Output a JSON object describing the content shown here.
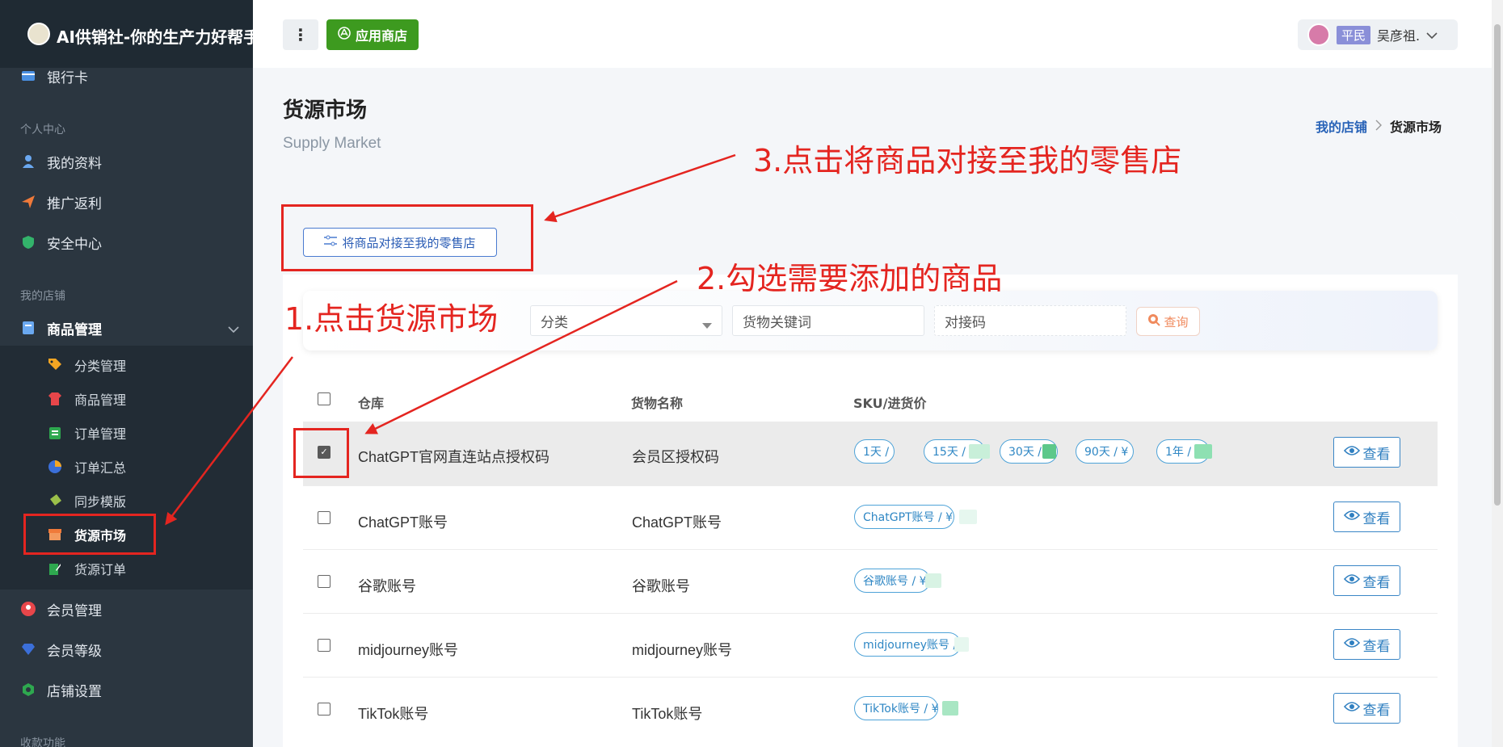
{
  "app": {
    "title": "AI供销社-你的生产力好帮手"
  },
  "header": {
    "store_button": "应用商店",
    "user_rank": "平民",
    "user_name": "吴彦祖."
  },
  "sidebar": {
    "top_item": "银行卡",
    "section_personal": "个人中心",
    "personal_items": [
      "我的资料",
      "推广返利",
      "安全中心"
    ],
    "section_store": "我的店铺",
    "goods_menu": "商品管理",
    "sub_items": [
      "分类管理",
      "商品管理",
      "订单管理",
      "订单汇总",
      "同步模版",
      "货源市场",
      "货源订单"
    ],
    "bottom_items": [
      "会员管理",
      "会员等级",
      "店铺设置"
    ],
    "section_payment": "收款功能"
  },
  "page": {
    "title": "货源市场",
    "subtitle": "Supply Market",
    "breadcrumb": [
      "我的店铺",
      "货源市场"
    ]
  },
  "toolbar": {
    "dock_button": "将商品对接至我的零售店"
  },
  "filters": {
    "category_placeholder": "分类",
    "keyword_placeholder": "货物关键词",
    "code_placeholder": "对接码",
    "query_button": "查询"
  },
  "table": {
    "headers": [
      "仓库",
      "货物名称",
      "SKU/进货价"
    ],
    "view_label": "查看",
    "rows": [
      {
        "warehouse": "ChatGPT官网直连站点授权码",
        "name": "会员区授权码",
        "skus": [
          "1天 /",
          "15天 / ¥",
          "30天 /",
          "90天 / ¥",
          "1年 / ¥"
        ],
        "checked": true
      },
      {
        "warehouse": "ChatGPT账号",
        "name": "ChatGPT账号",
        "skus": [
          "ChatGPT账号 / ¥"
        ],
        "checked": false
      },
      {
        "warehouse": "谷歌账号",
        "name": "谷歌账号",
        "skus": [
          "谷歌账号 / ¥"
        ],
        "checked": false
      },
      {
        "warehouse": "midjourney账号",
        "name": "midjourney账号",
        "skus": [
          "midjourney账号 / ¥"
        ],
        "checked": false
      },
      {
        "warehouse": "TikTok账号",
        "name": "TikTok账号",
        "skus": [
          "TikTok账号 / ¥"
        ],
        "checked": false
      }
    ]
  },
  "annotations": {
    "step1": "1.点击货源市场",
    "step2": "2.勾选需要添加的商品",
    "step3": "3.点击将商品对接至我的零售店"
  },
  "colors": {
    "sidebar": "#2b3640",
    "accent_green": "#3d9a1f",
    "annotation_red": "#e42520",
    "link_blue": "#2a64b8"
  }
}
